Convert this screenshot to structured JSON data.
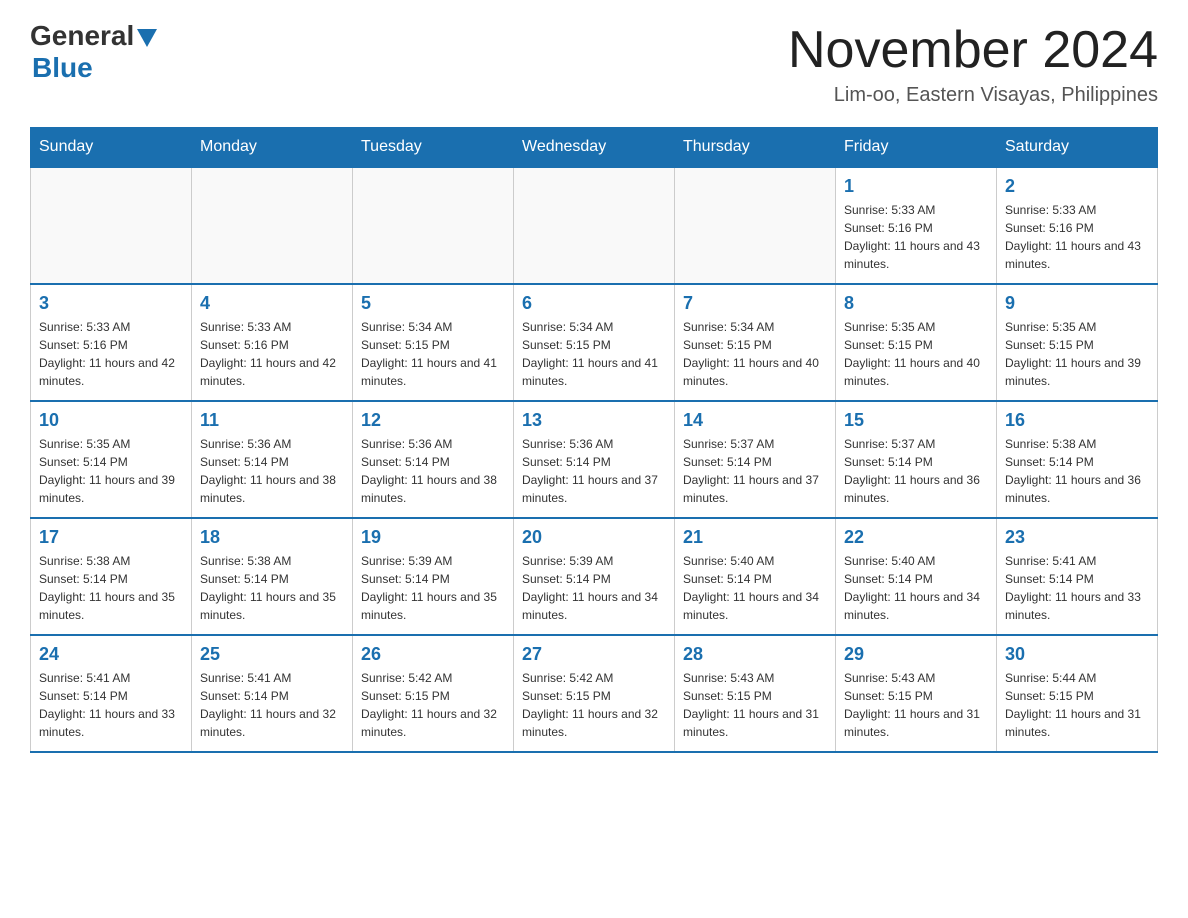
{
  "header": {
    "logo_general": "General",
    "logo_blue": "Blue",
    "month_title": "November 2024",
    "location": "Lim-oo, Eastern Visayas, Philippines"
  },
  "days_of_week": [
    "Sunday",
    "Monday",
    "Tuesday",
    "Wednesday",
    "Thursday",
    "Friday",
    "Saturday"
  ],
  "weeks": [
    [
      {
        "day": "",
        "info": ""
      },
      {
        "day": "",
        "info": ""
      },
      {
        "day": "",
        "info": ""
      },
      {
        "day": "",
        "info": ""
      },
      {
        "day": "",
        "info": ""
      },
      {
        "day": "1",
        "info": "Sunrise: 5:33 AM\nSunset: 5:16 PM\nDaylight: 11 hours and 43 minutes."
      },
      {
        "day": "2",
        "info": "Sunrise: 5:33 AM\nSunset: 5:16 PM\nDaylight: 11 hours and 43 minutes."
      }
    ],
    [
      {
        "day": "3",
        "info": "Sunrise: 5:33 AM\nSunset: 5:16 PM\nDaylight: 11 hours and 42 minutes."
      },
      {
        "day": "4",
        "info": "Sunrise: 5:33 AM\nSunset: 5:16 PM\nDaylight: 11 hours and 42 minutes."
      },
      {
        "day": "5",
        "info": "Sunrise: 5:34 AM\nSunset: 5:15 PM\nDaylight: 11 hours and 41 minutes."
      },
      {
        "day": "6",
        "info": "Sunrise: 5:34 AM\nSunset: 5:15 PM\nDaylight: 11 hours and 41 minutes."
      },
      {
        "day": "7",
        "info": "Sunrise: 5:34 AM\nSunset: 5:15 PM\nDaylight: 11 hours and 40 minutes."
      },
      {
        "day": "8",
        "info": "Sunrise: 5:35 AM\nSunset: 5:15 PM\nDaylight: 11 hours and 40 minutes."
      },
      {
        "day": "9",
        "info": "Sunrise: 5:35 AM\nSunset: 5:15 PM\nDaylight: 11 hours and 39 minutes."
      }
    ],
    [
      {
        "day": "10",
        "info": "Sunrise: 5:35 AM\nSunset: 5:14 PM\nDaylight: 11 hours and 39 minutes."
      },
      {
        "day": "11",
        "info": "Sunrise: 5:36 AM\nSunset: 5:14 PM\nDaylight: 11 hours and 38 minutes."
      },
      {
        "day": "12",
        "info": "Sunrise: 5:36 AM\nSunset: 5:14 PM\nDaylight: 11 hours and 38 minutes."
      },
      {
        "day": "13",
        "info": "Sunrise: 5:36 AM\nSunset: 5:14 PM\nDaylight: 11 hours and 37 minutes."
      },
      {
        "day": "14",
        "info": "Sunrise: 5:37 AM\nSunset: 5:14 PM\nDaylight: 11 hours and 37 minutes."
      },
      {
        "day": "15",
        "info": "Sunrise: 5:37 AM\nSunset: 5:14 PM\nDaylight: 11 hours and 36 minutes."
      },
      {
        "day": "16",
        "info": "Sunrise: 5:38 AM\nSunset: 5:14 PM\nDaylight: 11 hours and 36 minutes."
      }
    ],
    [
      {
        "day": "17",
        "info": "Sunrise: 5:38 AM\nSunset: 5:14 PM\nDaylight: 11 hours and 35 minutes."
      },
      {
        "day": "18",
        "info": "Sunrise: 5:38 AM\nSunset: 5:14 PM\nDaylight: 11 hours and 35 minutes."
      },
      {
        "day": "19",
        "info": "Sunrise: 5:39 AM\nSunset: 5:14 PM\nDaylight: 11 hours and 35 minutes."
      },
      {
        "day": "20",
        "info": "Sunrise: 5:39 AM\nSunset: 5:14 PM\nDaylight: 11 hours and 34 minutes."
      },
      {
        "day": "21",
        "info": "Sunrise: 5:40 AM\nSunset: 5:14 PM\nDaylight: 11 hours and 34 minutes."
      },
      {
        "day": "22",
        "info": "Sunrise: 5:40 AM\nSunset: 5:14 PM\nDaylight: 11 hours and 34 minutes."
      },
      {
        "day": "23",
        "info": "Sunrise: 5:41 AM\nSunset: 5:14 PM\nDaylight: 11 hours and 33 minutes."
      }
    ],
    [
      {
        "day": "24",
        "info": "Sunrise: 5:41 AM\nSunset: 5:14 PM\nDaylight: 11 hours and 33 minutes."
      },
      {
        "day": "25",
        "info": "Sunrise: 5:41 AM\nSunset: 5:14 PM\nDaylight: 11 hours and 32 minutes."
      },
      {
        "day": "26",
        "info": "Sunrise: 5:42 AM\nSunset: 5:15 PM\nDaylight: 11 hours and 32 minutes."
      },
      {
        "day": "27",
        "info": "Sunrise: 5:42 AM\nSunset: 5:15 PM\nDaylight: 11 hours and 32 minutes."
      },
      {
        "day": "28",
        "info": "Sunrise: 5:43 AM\nSunset: 5:15 PM\nDaylight: 11 hours and 31 minutes."
      },
      {
        "day": "29",
        "info": "Sunrise: 5:43 AM\nSunset: 5:15 PM\nDaylight: 11 hours and 31 minutes."
      },
      {
        "day": "30",
        "info": "Sunrise: 5:44 AM\nSunset: 5:15 PM\nDaylight: 11 hours and 31 minutes."
      }
    ]
  ]
}
